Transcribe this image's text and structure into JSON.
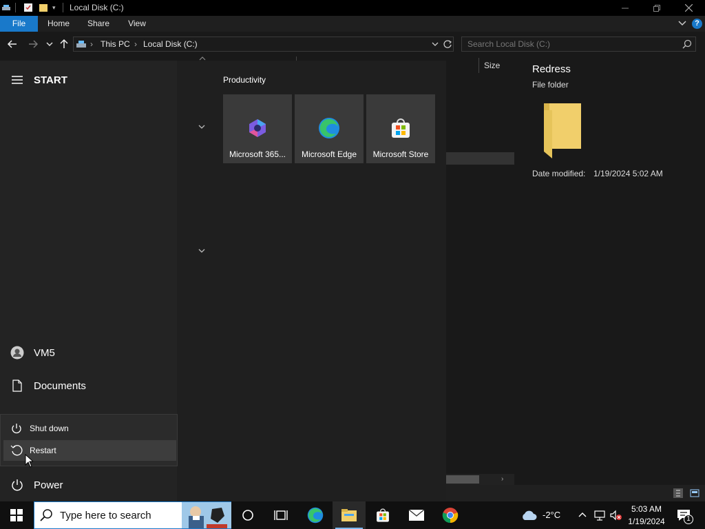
{
  "window": {
    "title": "Local Disk (C:)"
  },
  "ribbon": {
    "tabs": [
      "File",
      "Home",
      "Share",
      "View"
    ]
  },
  "address": {
    "crumbs": [
      "This PC",
      "Local Disk (C:)"
    ],
    "search_placeholder": "Search Local Disk (C:)"
  },
  "columns": {
    "size": "Size"
  },
  "details": {
    "name": "Redress",
    "type": "File folder",
    "date_label": "Date modified:",
    "date_value": "1/19/2024 5:02 AM"
  },
  "start": {
    "header": "START",
    "group_title": "Productivity",
    "tiles": [
      "Microsoft 365...",
      "Microsoft Edge",
      "Microsoft Store"
    ],
    "rail": {
      "user": "VM5",
      "documents": "Documents",
      "power": "Power"
    },
    "power_menu": [
      "Shut down",
      "Restart"
    ]
  },
  "taskbar": {
    "search_placeholder": "Type here to search",
    "weather": "-2°C",
    "time": "5:03 AM",
    "date": "1/19/2024",
    "notifications": "1"
  },
  "colors": {
    "accent": "#1979ca",
    "tile": "#3a3a3a",
    "folder": "#f1cf6b"
  }
}
